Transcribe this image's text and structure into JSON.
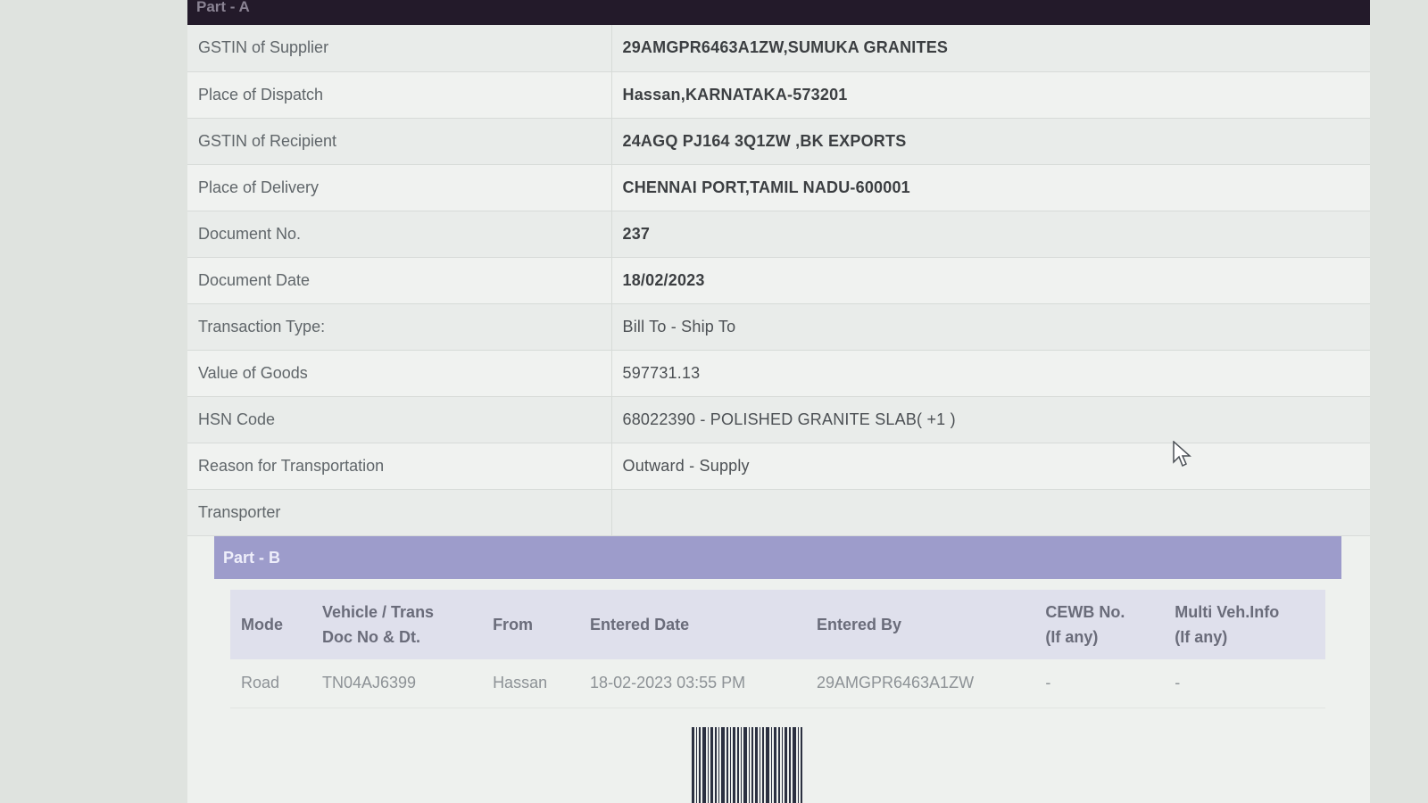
{
  "part_a": {
    "header": "Part - A",
    "rows": [
      {
        "label": "GSTIN of Supplier",
        "value": "29AMGPR6463A1ZW,SUMUKA GRANITES"
      },
      {
        "label": "Place of Dispatch",
        "value": "Hassan,KARNATAKA-573201"
      },
      {
        "label": "GSTIN of Recipient",
        "value": "24AGQ PJ164 3Q1ZW ,BK EXPORTS"
      },
      {
        "label": "Place of Delivery",
        "value": "CHENNAI PORT,TAMIL NADU-600001"
      },
      {
        "label": "Document No.",
        "value": "237"
      },
      {
        "label": "Document Date",
        "value": "18/02/2023"
      },
      {
        "label": "Transaction Type:",
        "value": "Bill To - Ship To"
      },
      {
        "label": "Value of Goods",
        "value": "597731.13"
      },
      {
        "label": "HSN Code",
        "value": "68022390 - POLISHED GRANITE SLAB( +1 )"
      },
      {
        "label": "Reason for Transportation",
        "value": "Outward - Supply"
      },
      {
        "label": "Transporter",
        "value": ""
      }
    ]
  },
  "part_b": {
    "header": "Part - B",
    "columns": {
      "mode": "Mode",
      "vehicle_line1": "Vehicle / Trans",
      "vehicle_line2": "Doc No & Dt.",
      "from": "From",
      "entered_date": "Entered Date",
      "entered_by": "Entered By",
      "cewb_line1": "CEWB No.",
      "cewb_line2": "(If any)",
      "multi_line1": "Multi Veh.Info",
      "multi_line2": "(If any)"
    },
    "row": {
      "mode": "Road",
      "vehicle": "TN04AJ6399",
      "from": "Hassan",
      "entered_date": "18-02-2023 03:55 PM",
      "entered_by": "29AMGPR6463A1ZW",
      "cewb": "-",
      "multi": "-"
    }
  },
  "icons": {
    "cursor": "mouse-pointer-icon",
    "barcode": "barcode-icon"
  },
  "colors": {
    "part_a_header": "#231a2a",
    "part_b_header": "#9d9ccb"
  }
}
